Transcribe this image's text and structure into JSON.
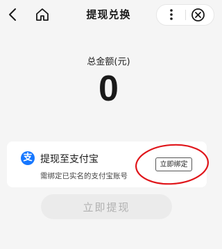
{
  "header": {
    "title": "提现兑换",
    "back_icon": "chevron-left-icon",
    "home_icon": "home-icon",
    "more_icon": "more-vertical-icon",
    "close_icon": "close-circle-icon"
  },
  "summary": {
    "label": "总金额(元)",
    "amount": "0"
  },
  "withdraw_method": {
    "icon": "alipay-icon",
    "icon_glyph": "支",
    "title": "提现至支付宝",
    "subtitle": "需绑定已实名的支付宝账号",
    "bind_label": "立即绑定"
  },
  "actions": {
    "withdraw_label": "立即提现"
  },
  "colors": {
    "alipay_blue": "#1677ff",
    "annotation_red": "#e0161b",
    "disabled_button_bg": "#ebebeb",
    "disabled_button_text": "#b0b0b0"
  }
}
